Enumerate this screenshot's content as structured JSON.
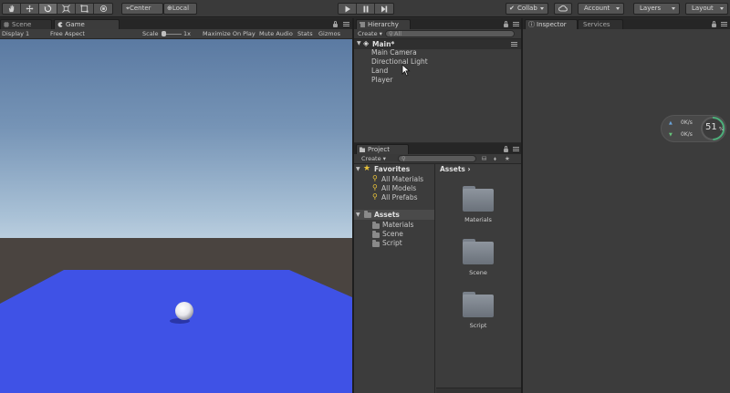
{
  "toolbar": {
    "pivot_label": "Center",
    "space_label": "Local",
    "collab_label": "Collab",
    "account_label": "Account",
    "layers_label": "Layers",
    "layout_label": "Layout"
  },
  "scene_tabs": {
    "scene_label": "Scene",
    "game_label": "Game"
  },
  "game_bar": {
    "display": "Display 1",
    "aspect": "Free Aspect",
    "scale_label": "Scale",
    "scale_value": "1x",
    "maximize": "Maximize On Play",
    "mute": "Mute Audio",
    "stats": "Stats",
    "gizmos": "Gizmos"
  },
  "hierarchy": {
    "tab_label": "Hierarchy",
    "create_label": "Create",
    "search_placeholder": "All",
    "scene_name": "Main*",
    "items": [
      "Main Camera",
      "Directional Light",
      "Land",
      "Player"
    ]
  },
  "project": {
    "tab_label": "Project",
    "create_label": "Create",
    "favorites_label": "Favorites",
    "favorites": [
      "All Materials",
      "All Models",
      "All Prefabs"
    ],
    "assets_label": "Assets",
    "asset_folders": [
      "Materials",
      "Scene",
      "Script"
    ],
    "breadcrumb": "Assets",
    "grid_items": [
      "Materials",
      "Scene",
      "Script"
    ]
  },
  "inspector": {
    "tab_label": "Inspector",
    "services_label": "Services"
  },
  "network_widget": {
    "upload": "0K/s",
    "download": "0K/s",
    "percent": "51",
    "percent_unit": "%"
  },
  "colors": {
    "sky_top": "#5f7fa6",
    "sky_horizon": "#e6eef3",
    "ground": "#4a4440",
    "plane": "#3f52e6",
    "panel": "#3c3c3c",
    "accent_yellow": "#e8c23a"
  }
}
